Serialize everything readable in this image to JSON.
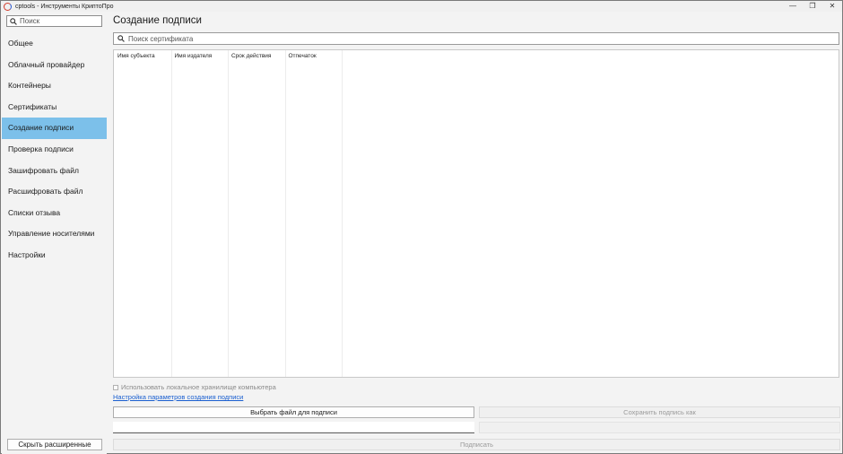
{
  "window": {
    "title": "cptools - Инструменты КриптоПро",
    "controls": {
      "minimize": "—",
      "maximize": "❐",
      "close": "✕"
    }
  },
  "sidebar": {
    "search_placeholder": "Поиск",
    "items": [
      {
        "label": "Общее"
      },
      {
        "label": "Облачный провайдер"
      },
      {
        "label": "Контейнеры"
      },
      {
        "label": "Сертификаты"
      },
      {
        "label": "Создание подписи",
        "active": true
      },
      {
        "label": "Проверка подписи"
      },
      {
        "label": "Зашифровать файл"
      },
      {
        "label": "Расшифровать файл"
      },
      {
        "label": "Списки отзыва"
      },
      {
        "label": "Управление носителями"
      },
      {
        "label": "Настройки"
      }
    ],
    "collapse_button": "Скрыть расширенные"
  },
  "main": {
    "title": "Создание подписи",
    "search_placeholder": "Поиск сертификата",
    "table": {
      "columns": [
        "Имя субъекта",
        "Имя издателя",
        "Срок действия",
        "Отпечаток"
      ],
      "rows": []
    },
    "use_local_store_label": "Использовать локальное хранилище компьютера",
    "settings_link": "Настройка параметров создания подписи",
    "choose_file_button": "Выбрать файл для подписи",
    "save_signature_button": "Сохранить подпись как",
    "sign_button": "Подписать"
  },
  "colors": {
    "active_nav": "#7cc0ea",
    "link": "#1a5fd0",
    "background": "#f3f3f3"
  },
  "icons": {
    "sidebar_search": "search-icon",
    "cert_search": "search-icon"
  }
}
